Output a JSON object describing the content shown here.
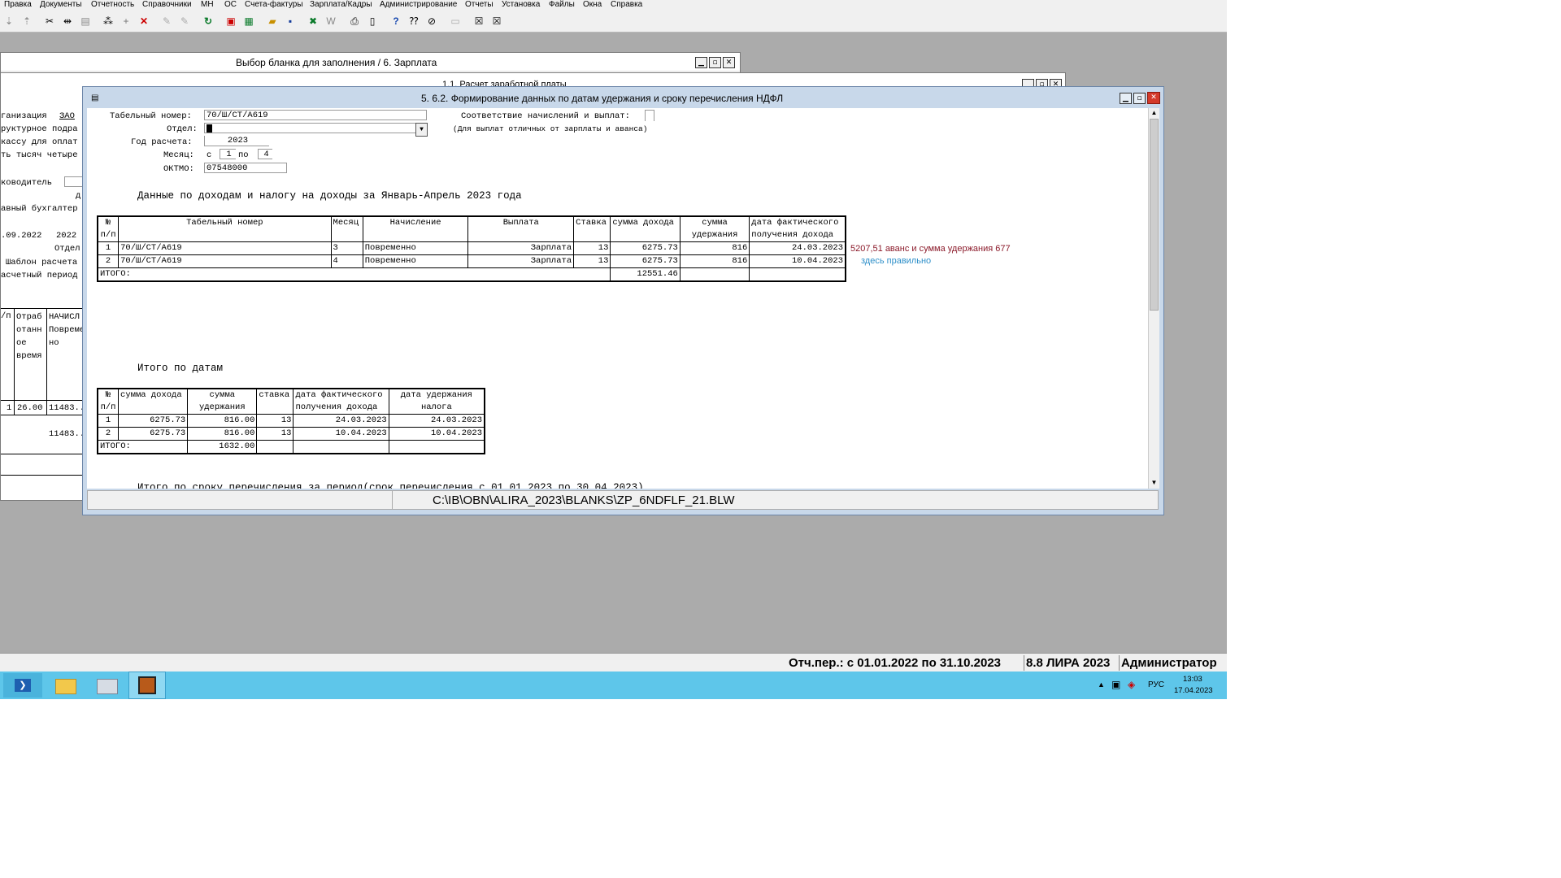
{
  "menu": [
    "Правка",
    "Документы",
    "Отчетность",
    "Справочники",
    "МН",
    "ОС",
    "Счета-фактуры",
    "Зарплата/Кадры",
    "Администрирование",
    "Отчеты",
    "Установка",
    "Файлы",
    "Окна",
    "Справка"
  ],
  "back_window": {
    "title": "Выбор бланка для заполнения /     6. Зарплата",
    "subtitle": "1.1. Расчет заработной платы",
    "left_labels": [
      "ганизация",
      "руктурное подра",
      "кассу для оплат",
      "ть тысяч четыре",
      "ководитель",
      "д",
      "авный бухгалтер",
      ".09.2022",
      "Отдел",
      "Шаблон расчета",
      "асчетный период"
    ],
    "org_value": "ЗАО",
    "year_value": "2022",
    "grid_head": [
      "№ п/п",
      "Отраб отанн ое время",
      "НАЧИСЛ Повреме но"
    ],
    "row": {
      "n": "1",
      "hours": "26.00",
      "sum": "11483.."
    },
    "row2_sum": "11483.."
  },
  "main": {
    "title": "5.  6.2. Формирование данных по датам удержания и сроку перечисления НДФЛ",
    "labels": {
      "tab": "Табельный номер:",
      "dept": "Отдел:",
      "year": "Год расчета:",
      "month": "Месяц:",
      "oktmo": "ОКТМО:",
      "from": "с",
      "to": "по",
      "match": "Соответствие начислений и выплат:",
      "match_note": "(Для выплат отличных от зарплаты и аванса)"
    },
    "values": {
      "tab": "70/Ш/СТ/А619",
      "dept": "",
      "year": "2023",
      "month_from": "1",
      "month_to": "4",
      "oktmo": "07548000"
    },
    "section1_title": "Данные по доходам и налогу на доходы за Январь-Апрель 2023 года",
    "t1_head": {
      "n": "№",
      "np": "п/п",
      "tab": "Табельный номер",
      "month": "Месяц",
      "accr": "Начисление",
      "pay": "Выплата",
      "rate": "Ставка",
      "income": "сумма дохода",
      "held1": "сумма",
      "held2": "удержания",
      "date1": "дата фактического",
      "date2": "получения дохода"
    },
    "t1_rows": [
      {
        "n": "1",
        "tab": "70/Ш/СТ/А619",
        "month": "3",
        "accr": "Повременно",
        "pay": "Зарплата",
        "rate": "13",
        "income": "6275.73",
        "held": "816",
        "date": "24.03.2023"
      },
      {
        "n": "2",
        "tab": "70/Ш/СТ/А619",
        "month": "4",
        "accr": "Повременно",
        "pay": "Зарплата",
        "rate": "13",
        "income": "6275.73",
        "held": "816",
        "date": "10.04.2023"
      }
    ],
    "t1_total_label": "ИТОГО:",
    "t1_total_income": "12551.46",
    "note1": "5207,51 аванс и сумма удержания 677",
    "note2": "здесь правильно",
    "note1_color": "#8b1a2a",
    "note2_color": "#2e8fc9",
    "section2_title": "Итого по датам",
    "t2_head": {
      "n": "№",
      "np": "п/п",
      "income": "сумма дохода",
      "held1": "сумма",
      "held2": "удержания",
      "rate": "ставка",
      "date1a": "дата фактического",
      "date1b": "получения дохода",
      "date2a": "дата удержания",
      "date2b": "налога"
    },
    "t2_rows": [
      {
        "n": "1",
        "income": "6275.73",
        "held": "816.00",
        "rate": "13",
        "date1": "24.03.2023",
        "date2": "24.03.2023"
      },
      {
        "n": "2",
        "income": "6275.73",
        "held": "816.00",
        "rate": "13",
        "date1": "10.04.2023",
        "date2": "10.04.2023"
      }
    ],
    "t2_total_label": "ИТОГО:",
    "t2_total_held": "1632.00",
    "section3_title": "Итого по сроку перечисления за период(срок перечисления с 01.01.2023 по 30.04.2023)",
    "path": "C:\\IB\\OBN\\ALIRA_2023\\BLANKS\\ZP_6NDFLF_21.BLW"
  },
  "status": {
    "period": "Отч.пер.: с 01.01.2022 по 31.10.2023",
    "version": "8.8 ЛИРА 2023",
    "user": "Администратор"
  },
  "tray": {
    "lang": "РУС",
    "time": "13:03",
    "date": "17.04.2023"
  }
}
